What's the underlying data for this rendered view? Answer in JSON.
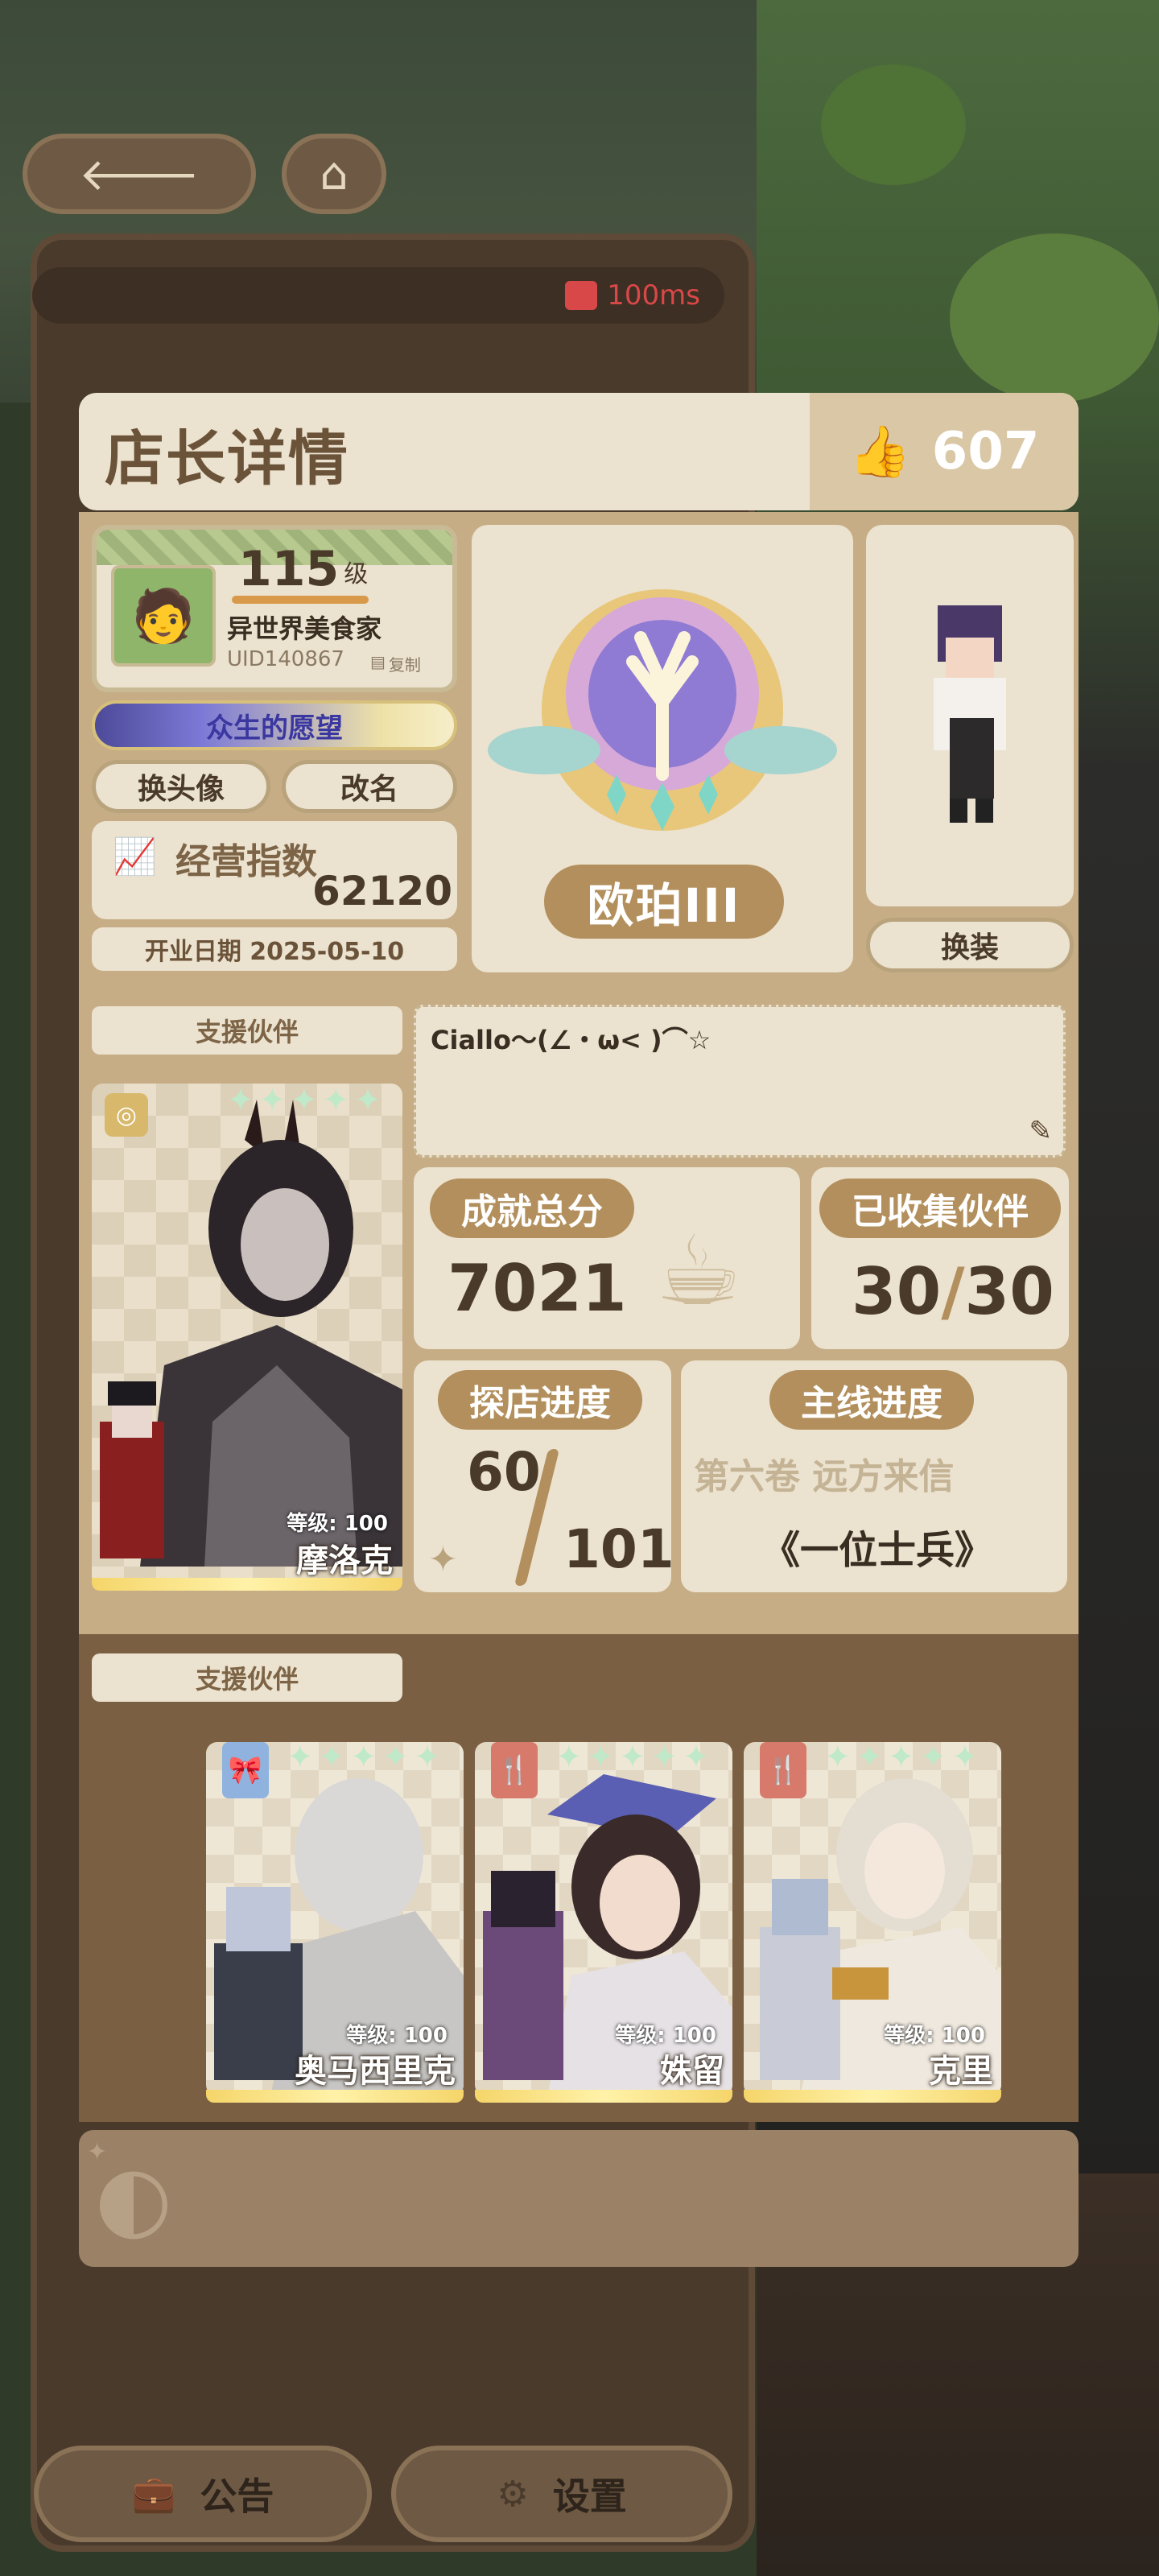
{
  "network": {
    "ping": "100ms"
  },
  "header": {
    "title": "店长详情",
    "likes": "607"
  },
  "profile": {
    "level": "115",
    "level_unit": "级",
    "title": "异世界美食家",
    "uid": "UID140867",
    "copy_label": "复制",
    "wish_label": "众生的愿望",
    "change_avatar_label": "换头像",
    "rename_label": "改名",
    "business_index_label": "经营指数",
    "business_index_value": "62120",
    "open_date": "开业日期 2025-05-10"
  },
  "rank": {
    "name": "欧珀III"
  },
  "character": {
    "dress_label": "换装"
  },
  "main_partner": {
    "section_label": "支援伙伴",
    "level": "等级: 100",
    "name": "摩洛克",
    "stars": 5
  },
  "message": "Ciallo～(∠・ω< )⌒☆",
  "stats": {
    "achievement_label": "成就总分",
    "achievement_value": "7021",
    "collected_label": "已收集伙伴",
    "collected_have": "30",
    "collected_sep": "/",
    "collected_total": "30",
    "explore_label": "探店进度",
    "explore_have": "60",
    "explore_total": "101",
    "story_label": "主线进度",
    "story_volume": "第六卷 远方来信",
    "story_chapter": "《一位士兵》"
  },
  "support_partners": {
    "section_label": "支援伙伴",
    "items": [
      {
        "name": "奥马西里克",
        "level": "等级: 100",
        "stars": 5,
        "type_color": "#8fb3de"
      },
      {
        "name": "姝留",
        "level": "等级: 100",
        "stars": 5,
        "type_color": "#d77a6c"
      },
      {
        "name": "克里",
        "level": "等级: 100",
        "stars": 5,
        "type_color": "#d77a6c"
      }
    ]
  },
  "footer": {
    "notice_label": "公告",
    "settings_label": "设置"
  },
  "colors": {
    "accent": "#b28f5c",
    "panel": "#ebe2cf",
    "frame": "#c6ad85"
  }
}
